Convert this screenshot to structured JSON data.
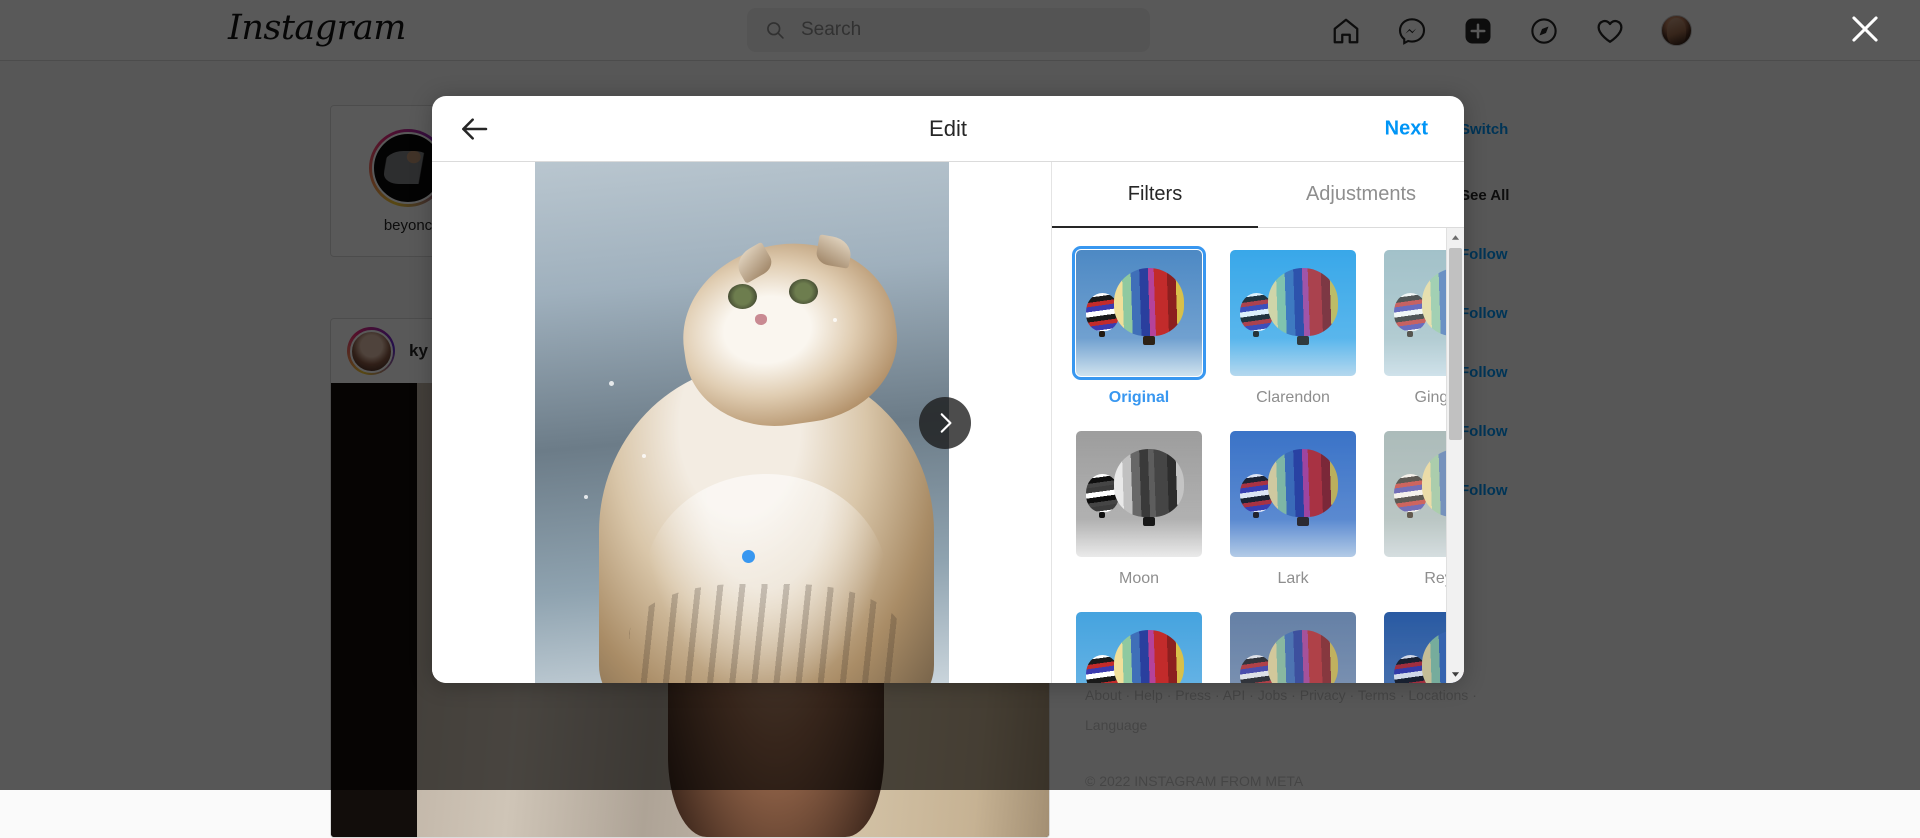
{
  "header": {
    "logo": "Instagram",
    "search": {
      "placeholder": "Search",
      "value": ""
    },
    "icons": [
      {
        "name": "home-icon",
        "label": "Home"
      },
      {
        "name": "messenger-icon",
        "label": "Messenger"
      },
      {
        "name": "new-post-icon",
        "label": "New post"
      },
      {
        "name": "explore-icon",
        "label": "Explore"
      },
      {
        "name": "activity-heart-icon",
        "label": "Notifications"
      },
      {
        "name": "profile-avatar",
        "label": "Profile"
      }
    ]
  },
  "overlay": {
    "close_label": "×"
  },
  "feed": {
    "story": {
      "username": "beyonc"
    },
    "post": {
      "username": "ky"
    }
  },
  "sidebar": {
    "switch_label": "Switch",
    "see_all_label": "See All",
    "follow_label": "Follow",
    "follow_count": 5
  },
  "footer": {
    "links": "About · Help · Press · API · Jobs · Privacy · Terms · Locations · Language",
    "copyright": "© 2022 INSTAGRAM FROM META"
  },
  "modal": {
    "title": "Edit",
    "back_label": "←",
    "next_label": "Next",
    "tabs": [
      {
        "label": "Filters",
        "active": true
      },
      {
        "label": "Adjustments",
        "active": false
      }
    ],
    "carousel": {
      "next_label": "›",
      "current_index": 1,
      "total": 2
    },
    "filters": [
      {
        "name": "Original",
        "selected": true,
        "sky": "#4d89c4",
        "overlay": "none",
        "gray": false
      },
      {
        "name": "Clarendon",
        "selected": false,
        "sky": "#38a7e8",
        "overlay": "rgba(60,170,240,0.18)",
        "gray": false
      },
      {
        "name": "Gingham",
        "selected": false,
        "sky": "#8fb4bf",
        "overlay": "rgba(210,225,225,0.30)",
        "gray": false
      },
      {
        "name": "Moon",
        "selected": false,
        "sky": "#9a9a9a",
        "overlay": "none",
        "gray": true
      },
      {
        "name": "Lark",
        "selected": false,
        "sky": "#3f79c9",
        "overlay": "rgba(40,90,190,0.16)",
        "gray": false
      },
      {
        "name": "Reyes",
        "selected": false,
        "sky": "#90aeb5",
        "overlay": "rgba(225,215,195,0.34)",
        "gray": false
      },
      {
        "name": "",
        "selected": false,
        "sky": "#45a3df",
        "overlay": "none",
        "gray": false
      },
      {
        "name": "",
        "selected": false,
        "sky": "#5f7fa8",
        "overlay": "rgba(120,130,160,0.25)",
        "gray": false
      },
      {
        "name": "",
        "selected": false,
        "sky": "#2f62a8",
        "overlay": "rgba(20,60,140,0.20)",
        "gray": false
      }
    ]
  },
  "colors": {
    "accent": "#0095f6",
    "selected_filter": "#3897f0",
    "text_primary": "#262626",
    "text_muted": "#8e8e8e",
    "border": "#dbdbdb",
    "veil": "rgba(0,0,0,0.65)"
  }
}
